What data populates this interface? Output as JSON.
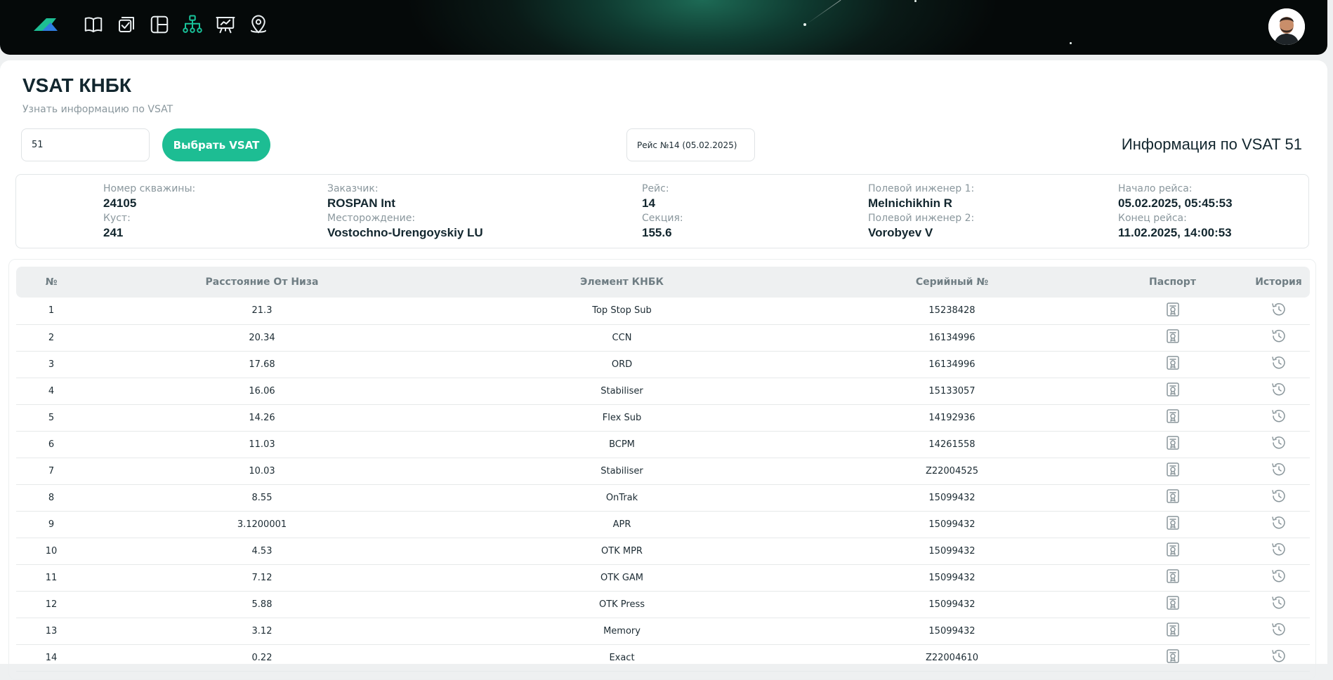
{
  "page": {
    "title": "VSAT КНБК",
    "subtitle": "Узнать информацию по VSAT",
    "vsat_input_value": "51",
    "select_button": "Выбрать VSAT",
    "trip_selected": "Рейс №14 (05.02.2025)",
    "info_heading": "Информация по VSAT 51"
  },
  "nav": [
    "book-icon",
    "tasks-icon",
    "dashboard-icon",
    "hierarchy-icon",
    "presentation-icon",
    "location-pin-icon"
  ],
  "info": {
    "well_label": "Номер скважины:",
    "well_value": "24105",
    "pad_label": "Куст:",
    "pad_value": "241",
    "customer_label": "Заказчик:",
    "customer_value": "ROSPAN Int",
    "field_label": "Месторождение:",
    "field_value": "Vostochno-Urengoyskiy LU",
    "trip_label": "Рейс:",
    "trip_value": "14",
    "section_label": "Секция:",
    "section_value": "155.6",
    "engineer1_label": "Полевой инженер 1:",
    "engineer1_value": "Melnichikhin R",
    "engineer2_label": "Полевой инженер 2:",
    "engineer2_value": "Vorobyev V",
    "start_label": "Начало рейса:",
    "start_value": "05.02.2025, 05:45:53",
    "end_label": "Конец рейса:",
    "end_value": "11.02.2025, 14:00:53"
  },
  "table": {
    "headers": [
      "№",
      "Расстояние От Низа",
      "Элемент КНБК",
      "Серийный №",
      "Паспорт",
      "История"
    ],
    "rows": [
      [
        "1",
        "21.3",
        "Top Stop Sub",
        "15238428"
      ],
      [
        "2",
        "20.34",
        "CCN",
        "16134996"
      ],
      [
        "3",
        "17.68",
        "ORD",
        "16134996"
      ],
      [
        "4",
        "16.06",
        "Stabiliser",
        "15133057"
      ],
      [
        "5",
        "14.26",
        "Flex Sub",
        "14192936"
      ],
      [
        "6",
        "11.03",
        "BCPM",
        "14261558"
      ],
      [
        "7",
        "10.03",
        "Stabiliser",
        "Z22004525"
      ],
      [
        "8",
        "8.55",
        "OnTrak",
        "15099432"
      ],
      [
        "9",
        "3.1200001",
        "APR",
        "15099432"
      ],
      [
        "10",
        "4.53",
        "OTK MPR",
        "15099432"
      ],
      [
        "11",
        "7.12",
        "OTK GAM",
        "15099432"
      ],
      [
        "12",
        "5.88",
        "OTK Press",
        "15099432"
      ],
      [
        "13",
        "3.12",
        "Memory",
        "15099432"
      ],
      [
        "14",
        "0.22",
        "Exact",
        "Z22004610"
      ]
    ]
  },
  "colors": {
    "accent": "#1dbd93",
    "active_nav": "#19c39a"
  }
}
